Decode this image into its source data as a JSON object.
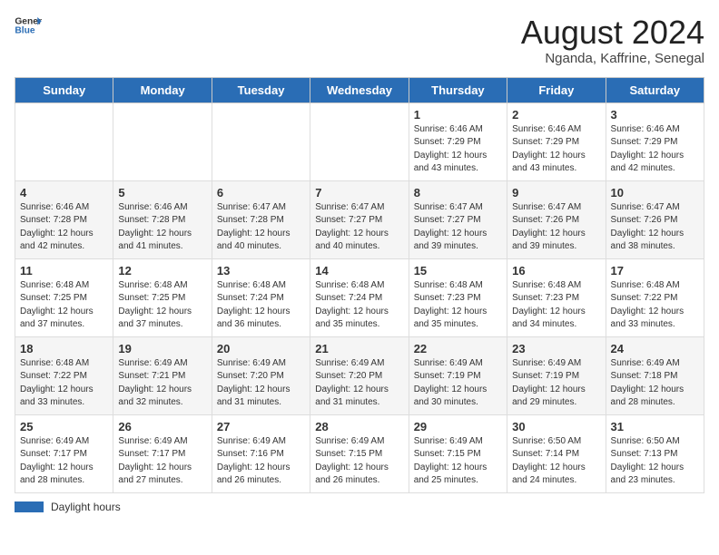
{
  "logo": {
    "general": "General",
    "blue": "Blue"
  },
  "title": "August 2024",
  "subtitle": "Nganda, Kaffrine, Senegal",
  "days_of_week": [
    "Sunday",
    "Monday",
    "Tuesday",
    "Wednesday",
    "Thursday",
    "Friday",
    "Saturday"
  ],
  "weeks": [
    [
      {
        "day": "",
        "sunrise": "",
        "sunset": "",
        "daylight": ""
      },
      {
        "day": "",
        "sunrise": "",
        "sunset": "",
        "daylight": ""
      },
      {
        "day": "",
        "sunrise": "",
        "sunset": "",
        "daylight": ""
      },
      {
        "day": "",
        "sunrise": "",
        "sunset": "",
        "daylight": ""
      },
      {
        "day": "1",
        "sunrise": "Sunrise: 6:46 AM",
        "sunset": "Sunset: 7:29 PM",
        "daylight": "Daylight: 12 hours and 43 minutes."
      },
      {
        "day": "2",
        "sunrise": "Sunrise: 6:46 AM",
        "sunset": "Sunset: 7:29 PM",
        "daylight": "Daylight: 12 hours and 43 minutes."
      },
      {
        "day": "3",
        "sunrise": "Sunrise: 6:46 AM",
        "sunset": "Sunset: 7:29 PM",
        "daylight": "Daylight: 12 hours and 42 minutes."
      }
    ],
    [
      {
        "day": "4",
        "sunrise": "Sunrise: 6:46 AM",
        "sunset": "Sunset: 7:28 PM",
        "daylight": "Daylight: 12 hours and 42 minutes."
      },
      {
        "day": "5",
        "sunrise": "Sunrise: 6:46 AM",
        "sunset": "Sunset: 7:28 PM",
        "daylight": "Daylight: 12 hours and 41 minutes."
      },
      {
        "day": "6",
        "sunrise": "Sunrise: 6:47 AM",
        "sunset": "Sunset: 7:28 PM",
        "daylight": "Daylight: 12 hours and 40 minutes."
      },
      {
        "day": "7",
        "sunrise": "Sunrise: 6:47 AM",
        "sunset": "Sunset: 7:27 PM",
        "daylight": "Daylight: 12 hours and 40 minutes."
      },
      {
        "day": "8",
        "sunrise": "Sunrise: 6:47 AM",
        "sunset": "Sunset: 7:27 PM",
        "daylight": "Daylight: 12 hours and 39 minutes."
      },
      {
        "day": "9",
        "sunrise": "Sunrise: 6:47 AM",
        "sunset": "Sunset: 7:26 PM",
        "daylight": "Daylight: 12 hours and 39 minutes."
      },
      {
        "day": "10",
        "sunrise": "Sunrise: 6:47 AM",
        "sunset": "Sunset: 7:26 PM",
        "daylight": "Daylight: 12 hours and 38 minutes."
      }
    ],
    [
      {
        "day": "11",
        "sunrise": "Sunrise: 6:48 AM",
        "sunset": "Sunset: 7:25 PM",
        "daylight": "Daylight: 12 hours and 37 minutes."
      },
      {
        "day": "12",
        "sunrise": "Sunrise: 6:48 AM",
        "sunset": "Sunset: 7:25 PM",
        "daylight": "Daylight: 12 hours and 37 minutes."
      },
      {
        "day": "13",
        "sunrise": "Sunrise: 6:48 AM",
        "sunset": "Sunset: 7:24 PM",
        "daylight": "Daylight: 12 hours and 36 minutes."
      },
      {
        "day": "14",
        "sunrise": "Sunrise: 6:48 AM",
        "sunset": "Sunset: 7:24 PM",
        "daylight": "Daylight: 12 hours and 35 minutes."
      },
      {
        "day": "15",
        "sunrise": "Sunrise: 6:48 AM",
        "sunset": "Sunset: 7:23 PM",
        "daylight": "Daylight: 12 hours and 35 minutes."
      },
      {
        "day": "16",
        "sunrise": "Sunrise: 6:48 AM",
        "sunset": "Sunset: 7:23 PM",
        "daylight": "Daylight: 12 hours and 34 minutes."
      },
      {
        "day": "17",
        "sunrise": "Sunrise: 6:48 AM",
        "sunset": "Sunset: 7:22 PM",
        "daylight": "Daylight: 12 hours and 33 minutes."
      }
    ],
    [
      {
        "day": "18",
        "sunrise": "Sunrise: 6:48 AM",
        "sunset": "Sunset: 7:22 PM",
        "daylight": "Daylight: 12 hours and 33 minutes."
      },
      {
        "day": "19",
        "sunrise": "Sunrise: 6:49 AM",
        "sunset": "Sunset: 7:21 PM",
        "daylight": "Daylight: 12 hours and 32 minutes."
      },
      {
        "day": "20",
        "sunrise": "Sunrise: 6:49 AM",
        "sunset": "Sunset: 7:20 PM",
        "daylight": "Daylight: 12 hours and 31 minutes."
      },
      {
        "day": "21",
        "sunrise": "Sunrise: 6:49 AM",
        "sunset": "Sunset: 7:20 PM",
        "daylight": "Daylight: 12 hours and 31 minutes."
      },
      {
        "day": "22",
        "sunrise": "Sunrise: 6:49 AM",
        "sunset": "Sunset: 7:19 PM",
        "daylight": "Daylight: 12 hours and 30 minutes."
      },
      {
        "day": "23",
        "sunrise": "Sunrise: 6:49 AM",
        "sunset": "Sunset: 7:19 PM",
        "daylight": "Daylight: 12 hours and 29 minutes."
      },
      {
        "day": "24",
        "sunrise": "Sunrise: 6:49 AM",
        "sunset": "Sunset: 7:18 PM",
        "daylight": "Daylight: 12 hours and 28 minutes."
      }
    ],
    [
      {
        "day": "25",
        "sunrise": "Sunrise: 6:49 AM",
        "sunset": "Sunset: 7:17 PM",
        "daylight": "Daylight: 12 hours and 28 minutes."
      },
      {
        "day": "26",
        "sunrise": "Sunrise: 6:49 AM",
        "sunset": "Sunset: 7:17 PM",
        "daylight": "Daylight: 12 hours and 27 minutes."
      },
      {
        "day": "27",
        "sunrise": "Sunrise: 6:49 AM",
        "sunset": "Sunset: 7:16 PM",
        "daylight": "Daylight: 12 hours and 26 minutes."
      },
      {
        "day": "28",
        "sunrise": "Sunrise: 6:49 AM",
        "sunset": "Sunset: 7:15 PM",
        "daylight": "Daylight: 12 hours and 26 minutes."
      },
      {
        "day": "29",
        "sunrise": "Sunrise: 6:49 AM",
        "sunset": "Sunset: 7:15 PM",
        "daylight": "Daylight: 12 hours and 25 minutes."
      },
      {
        "day": "30",
        "sunrise": "Sunrise: 6:50 AM",
        "sunset": "Sunset: 7:14 PM",
        "daylight": "Daylight: 12 hours and 24 minutes."
      },
      {
        "day": "31",
        "sunrise": "Sunrise: 6:50 AM",
        "sunset": "Sunset: 7:13 PM",
        "daylight": "Daylight: 12 hours and 23 minutes."
      }
    ]
  ],
  "legend": {
    "daylight_hours_label": "Daylight hours"
  }
}
